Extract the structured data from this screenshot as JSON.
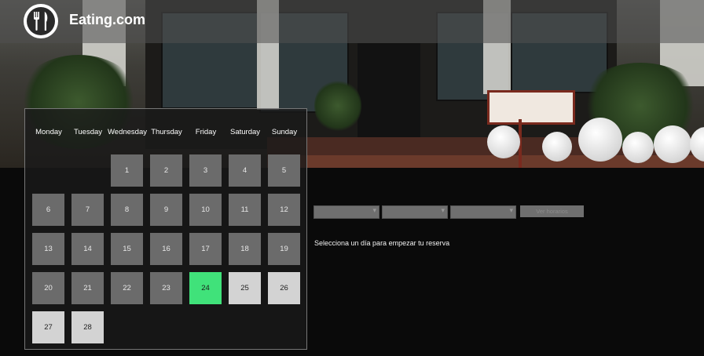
{
  "header": {
    "brand": "Eating.com",
    "logo_icon": "fork-knife-icon"
  },
  "calendar": {
    "weekdays": [
      "Monday",
      "Tuesday",
      "Wednesday",
      "Thursday",
      "Friday",
      "Saturday",
      "Sunday"
    ],
    "days": [
      "1",
      "2",
      "3",
      "4",
      "5",
      "6",
      "7",
      "8",
      "9",
      "10",
      "11",
      "12",
      "13",
      "14",
      "15",
      "16",
      "17",
      "18",
      "19",
      "20",
      "21",
      "22",
      "23",
      "24",
      "25",
      "26",
      "27",
      "28"
    ],
    "selected_day": "24",
    "colors": {
      "past": "#6b6b6b",
      "today": "#40e27a",
      "available": "#d3d3d3"
    }
  },
  "booking": {
    "hours_button": "Ver horarios",
    "hint": "Selecciona un día para empezar tu reserva"
  }
}
